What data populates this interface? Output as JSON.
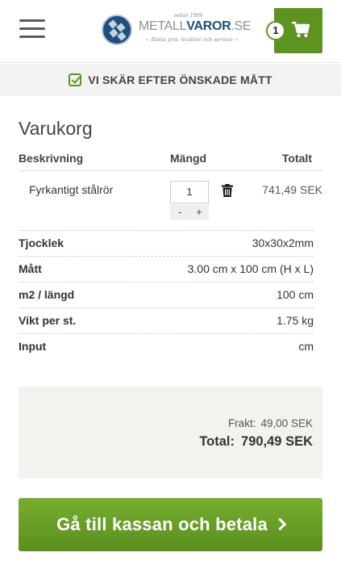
{
  "header": {
    "logo": {
      "since": "sedan 1999",
      "name_light": "METALL",
      "name_bold": "VAROR",
      "name_tld": ".SE",
      "tagline": "~ Bästa pris, kvalitet och service ~"
    },
    "cart_count": "1",
    "icons": [
      "hamburger-menu-icon",
      "cart-icon"
    ]
  },
  "banner": {
    "text": "VI SKÄR EFTER ÖNSKADE MÅTT",
    "icon": "checkbox-check-icon"
  },
  "cart": {
    "title": "Varukorg",
    "columns": {
      "description": "Beskrivning",
      "quantity": "Mängd",
      "total": "Totalt"
    },
    "item": {
      "name": "Fyrkantigt stålrör",
      "quantity": "1",
      "minus": "-",
      "plus": "+",
      "price": "741,49 SEK"
    },
    "specs": [
      {
        "label": "Tjocklek",
        "value": "30x30x2mm"
      },
      {
        "label": "Mått",
        "value": "3.00 cm x 100 cm (H x L)"
      },
      {
        "label": "m2 / längd",
        "value": "100 cm"
      },
      {
        "label": "Vikt per st.",
        "value": "1.75 kg"
      },
      {
        "label": "Input",
        "value": "cm"
      }
    ]
  },
  "summary": {
    "freight_label": "Frakt:",
    "freight_value": "49,00 SEK",
    "total_label": "Total:",
    "total_value": "790,49 SEK"
  },
  "checkout": {
    "label": "Gå till kassan och betala"
  },
  "colors": {
    "accent_green": "#5e9322",
    "brand_blue": "#1e4f7c"
  }
}
